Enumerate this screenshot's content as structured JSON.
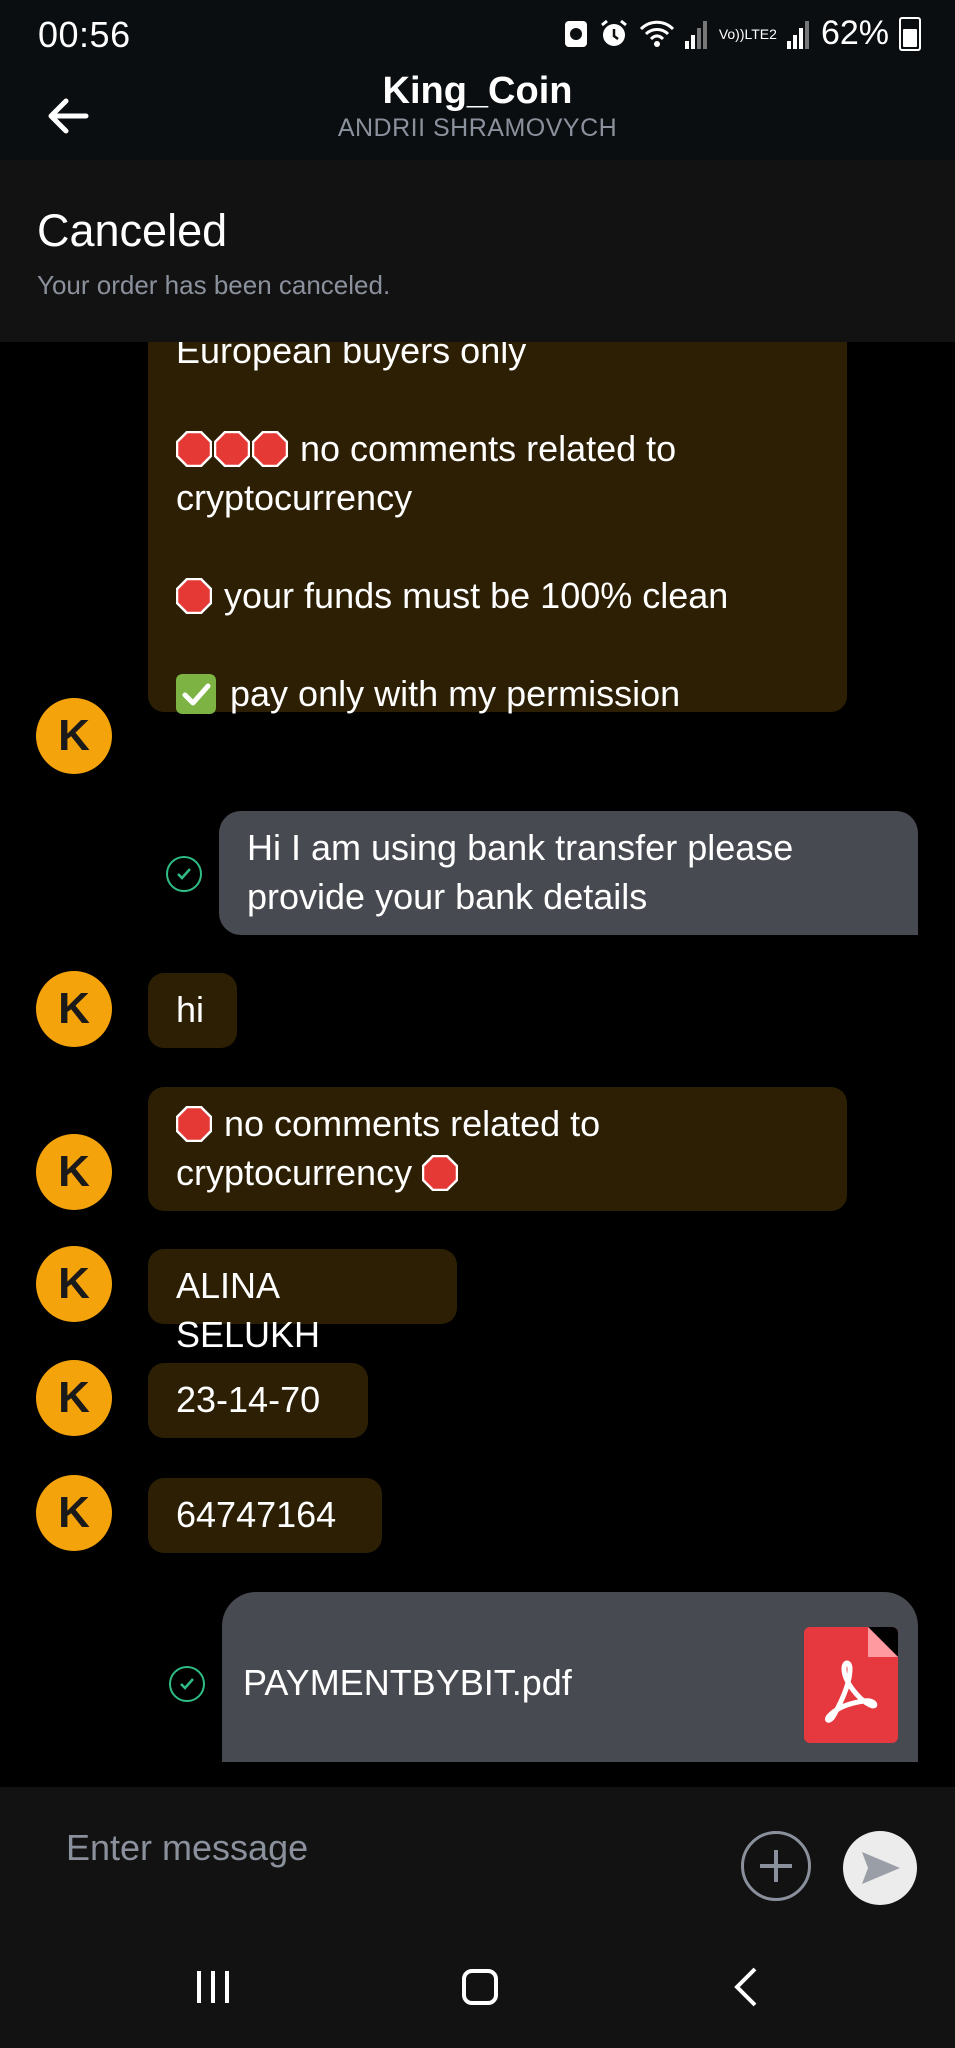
{
  "status_bar": {
    "time": "00:56",
    "battery": "62%",
    "network": "LTE2",
    "volte": "Vo))"
  },
  "header": {
    "title": "King_Coin",
    "subtitle": "ANDRII SHRAMOVYCH"
  },
  "order": {
    "status": "Canceled",
    "description": "Your order has been canceled."
  },
  "chat": {
    "avatar_letter": "K",
    "terms_message": {
      "line_1": "European buyers only",
      "line_2": "no comments related to cryptocurrency",
      "line_3": "your funds must be 100% clean",
      "line_4": "pay only with my permission"
    },
    "outgoing_1": "Hi I am using bank transfer please provide your bank details",
    "incoming_hi": "hi",
    "incoming_no_comments": "no comments related to cryptocurrency",
    "incoming_name": "ALINA SELUKH",
    "incoming_sort_code": "23-14-70",
    "incoming_account": "64747164",
    "file_name": "PAYMENTBYBIT.pdf"
  },
  "input": {
    "placeholder": "Enter message"
  },
  "icons": {
    "back": "arrow-left-icon",
    "add": "plus-circle-icon",
    "send": "send-icon",
    "stop": "stop-sign-emoji",
    "check": "check-mark-emoji",
    "pdf": "pdf-file-icon"
  },
  "colors": {
    "avatar": "#f5a30b",
    "incoming_bubble": "#2c1f04",
    "outgoing_bubble": "#474a50",
    "sent_check": "#2ebd85",
    "stop_emoji": "#e53935",
    "pdf_icon": "#e5393f"
  }
}
